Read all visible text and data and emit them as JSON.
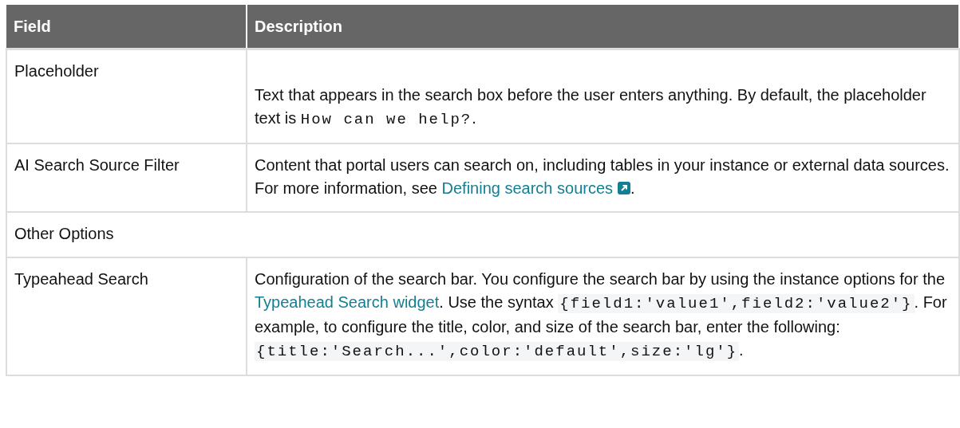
{
  "table": {
    "columns": [
      "Field",
      "Description"
    ],
    "rows": [
      {
        "kind": "field",
        "field": "Placeholder",
        "description": [
          {
            "kind": "text",
            "text": "Text that appears in the search box before the user enters anything. By default, the placeholder text is "
          },
          {
            "kind": "code",
            "text": "How can we help?",
            "shaded": false
          },
          {
            "kind": "text",
            "text": "."
          }
        ]
      },
      {
        "kind": "field",
        "field": "AI Search Source Filter",
        "description": [
          {
            "kind": "text",
            "text": "Content that portal users can search on, including tables in your instance or external data sources. For more information, see "
          },
          {
            "kind": "link",
            "text": "Defining search sources",
            "external": true
          },
          {
            "kind": "text",
            "text": "."
          }
        ]
      },
      {
        "kind": "section",
        "field": "Other Options"
      },
      {
        "kind": "field",
        "field": "Typeahead Search",
        "description": [
          {
            "kind": "text",
            "text": "Configuration of the search bar. You configure the search bar by using the instance options for the "
          },
          {
            "kind": "link",
            "text": "Typeahead Search widget",
            "external": false
          },
          {
            "kind": "text",
            "text": ". Use the syntax "
          },
          {
            "kind": "code",
            "text": "{field1:'value1',field2:'value2'}",
            "shaded": true
          },
          {
            "kind": "text",
            "text": ". For example, to configure the title, color, and size of the search bar, enter the following: "
          },
          {
            "kind": "code",
            "text": "{title:'Search...',color:'default',size:'lg'}",
            "shaded": true
          },
          {
            "kind": "text",
            "text": "."
          }
        ]
      }
    ]
  }
}
